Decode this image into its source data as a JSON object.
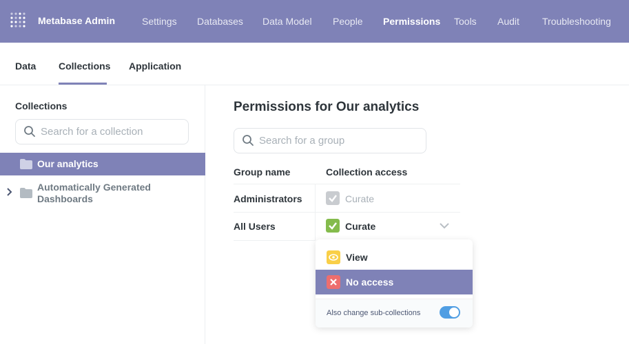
{
  "brand": "Metabase Admin",
  "nav": [
    "Settings",
    "Databases",
    "Data Model",
    "People",
    "Permissions",
    "Tools",
    "Audit",
    "Troubleshooting"
  ],
  "nav_active": "Permissions",
  "subtabs": [
    "Data",
    "Collections",
    "Application"
  ],
  "subtab_active": "Collections",
  "sidebar": {
    "heading": "Collections",
    "search_placeholder": "Search for a collection",
    "items": [
      {
        "label": "Our analytics",
        "selected": true
      },
      {
        "label": "Automatically Generated Dashboards",
        "expandable": true
      }
    ]
  },
  "main": {
    "title": "Permissions for Our analytics",
    "search_placeholder": "Search for a group",
    "columns": [
      "Group name",
      "Collection access"
    ],
    "rows": [
      {
        "group": "Administrators",
        "access": "Curate",
        "disabled": true
      },
      {
        "group": "All Users",
        "access": "Curate",
        "disabled": false
      }
    ]
  },
  "dropdown": {
    "options": [
      {
        "label": "View",
        "icon": "eye-icon",
        "color": "#f9cf48"
      },
      {
        "label": "No access",
        "icon": "close-icon",
        "color": "#ed6e6e",
        "highlighted": true
      }
    ],
    "footer_label": "Also change sub-collections",
    "toggle_on": true
  },
  "colors": {
    "brand": "#7f82b7",
    "curate_green": "#84bb4c",
    "toggle_blue": "#509ee3"
  }
}
